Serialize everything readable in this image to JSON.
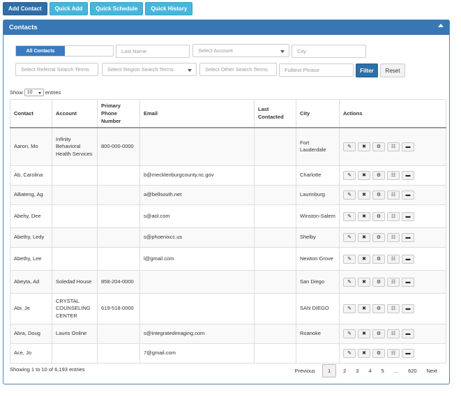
{
  "toolbar": {
    "add_contact": "Add Contact",
    "quick_add": "Quick Add",
    "quick_schedule": "Quick Schedule",
    "quick_history": "Quick History"
  },
  "panel": {
    "title": "Contacts"
  },
  "filters": {
    "all_contacts": "All Contacts",
    "last_name": "Last Name",
    "select_account": "Select Account",
    "city": "City",
    "referral": "Select Referral Search Terms",
    "region": "Select Region Search Terms",
    "other": "Select Other Search Terms",
    "fulltext": "Fulltext Phrase",
    "filter_button": "Filter",
    "reset_button": "Reset"
  },
  "length": {
    "show": "Show",
    "value": "10",
    "entries": "entries"
  },
  "table": {
    "headers": [
      "Contact",
      "Account",
      "Primary Phone Number",
      "Email",
      "Last Contacted",
      "City",
      "Actions"
    ],
    "rows": [
      {
        "contact": "Aaron, Mo",
        "account": "Infinity Behavioral Health Services",
        "phone": "800-000-0000",
        "email": "",
        "last": "",
        "city": "Fort Lauderdale"
      },
      {
        "contact": "Ab, Carolina",
        "account": "",
        "phone": "",
        "email": "b@mecklenburgcounty.nc.gov",
        "last": "",
        "city": "Charlotte"
      },
      {
        "contact": "ABateng, Ag",
        "account": "",
        "phone": "",
        "email": "a@bellsouth.net",
        "last": "",
        "city": "Laurinburg"
      },
      {
        "contact": "Abehy, Dee",
        "account": "",
        "phone": "",
        "email": "s@aol.com",
        "last": "",
        "city": "Winston-Salem"
      },
      {
        "contact": "Abethy, Ledy",
        "account": "",
        "phone": "",
        "email": "s@phoenixcc.us",
        "last": "",
        "city": "Shelby"
      },
      {
        "contact": "Abethy, Lee",
        "account": "",
        "phone": "",
        "email": "l@gmail.com",
        "last": "",
        "city": "Newton Grove"
      },
      {
        "contact": "Abeyta, Ad",
        "account": "Soledad House",
        "phone": "858-204-0000",
        "email": "",
        "last": "",
        "city": "San Diego"
      },
      {
        "contact": "Abi, Je",
        "account": "CRYSTAL COUNSELING CENTER",
        "phone": "619-518-0000",
        "email": "",
        "last": "",
        "city": "SAN DIEGO"
      },
      {
        "contact": "Abra, Doug",
        "account": "Lauris Online",
        "phone": "",
        "email": "s@integratedimaging.com",
        "last": "",
        "city": "Roanoke"
      },
      {
        "contact": "Ace, Jo",
        "account": "",
        "phone": "",
        "email": "7@gmail.com",
        "last": "",
        "city": ""
      }
    ]
  },
  "action_icons": [
    "edit-icon",
    "delete-icon",
    "settings-icon",
    "calendar-icon",
    "comment-icon"
  ],
  "info": "Showing 1 to 10 of 6,193 entries",
  "pagination": [
    "Previous",
    "1",
    "2",
    "3",
    "4",
    "5",
    "...",
    "620",
    "Next"
  ],
  "colors": {
    "primary": "#3777b3",
    "info": "#45b6dc"
  }
}
